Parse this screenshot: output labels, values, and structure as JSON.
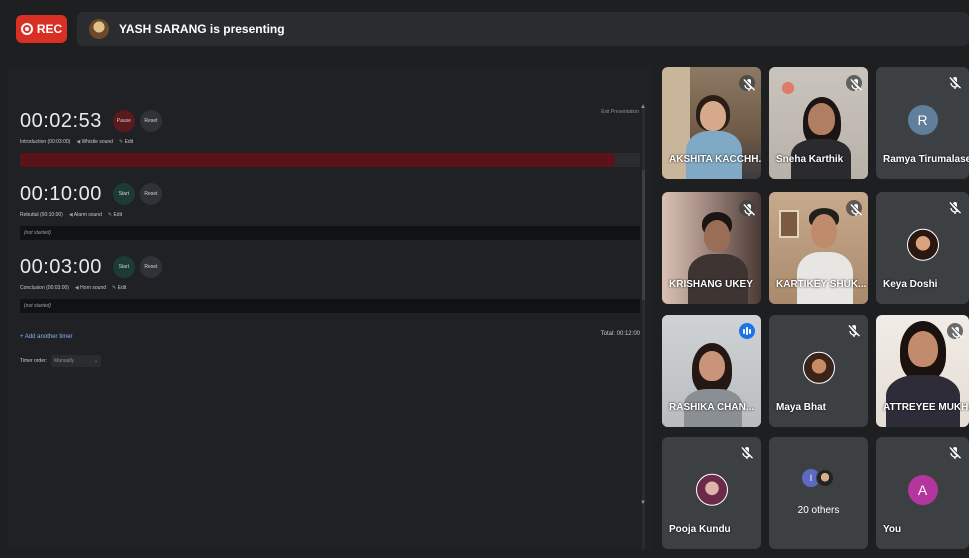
{
  "top_bar": {
    "rec_label": "REC",
    "presenting_text": "YASH SARANG is presenting"
  },
  "presentation": {
    "exit_label": "Exit Presentation",
    "timers": [
      {
        "time": "00:02:53",
        "primary_button": "Pause",
        "reset_button": "Reset",
        "name_line": "Introduction (00:03:00)",
        "sound": "Whistle sound",
        "edit": "Edit",
        "status": "",
        "progress": 0.96,
        "state": "running"
      },
      {
        "time": "00:10:00",
        "primary_button": "Start",
        "reset_button": "Reset",
        "name_line": "Rebuttal (00:10:00)",
        "sound": "Alarm sound",
        "edit": "Edit",
        "status": "(not started)",
        "progress": 0,
        "state": "idle"
      },
      {
        "time": "00:03:00",
        "primary_button": "Start",
        "reset_button": "Reset",
        "name_line": "Conclusion (00:03:00)",
        "sound": "Horn sound",
        "edit": "Edit",
        "status": "(not started)",
        "progress": 0,
        "state": "idle"
      }
    ],
    "add_timer": "+ Add another timer",
    "total": "Total: 00:12:00",
    "timer_order_label": "Timer order:",
    "timer_order_value": "Manually"
  },
  "participants": [
    {
      "name": "AKSHITA KACCHH...",
      "muted": true,
      "kind": "video"
    },
    {
      "name": "Sneha Karthik",
      "muted": true,
      "kind": "video"
    },
    {
      "name": "Ramya Tirumalase...",
      "muted": true,
      "kind": "letter",
      "letter": "R",
      "color": "#5f7f9a"
    },
    {
      "name": "KRISHANG UKEY",
      "muted": true,
      "kind": "video"
    },
    {
      "name": "KARTIKEY SHUK...",
      "muted": true,
      "kind": "video"
    },
    {
      "name": "Keya Doshi",
      "muted": true,
      "kind": "photo"
    },
    {
      "name": "RASHIKA CHAN...",
      "muted": false,
      "kind": "video",
      "speaking": true
    },
    {
      "name": "Maya Bhat",
      "muted": true,
      "kind": "photo"
    },
    {
      "name": "ATTREYEE MUKH...",
      "muted": true,
      "kind": "video"
    },
    {
      "name": "Pooja Kundu",
      "muted": true,
      "kind": "photo"
    },
    {
      "name": "20 others",
      "muted": false,
      "kind": "others",
      "letter": "I"
    },
    {
      "name": "You",
      "muted": true,
      "kind": "letter",
      "letter": "A",
      "color": "#b5359e"
    }
  ],
  "colors": {
    "rec": "#d93025",
    "speaking": "#1a73e8",
    "pause": "#5a1a1d",
    "start": "#1d3b35"
  }
}
